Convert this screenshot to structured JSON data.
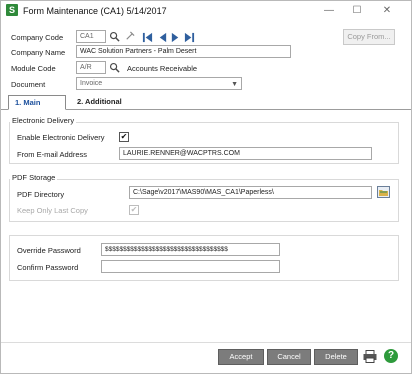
{
  "window": {
    "title": "Form Maintenance (CA1) 5/14/2017",
    "app_icon": "S",
    "icons": {
      "app": "sage-logo-icon",
      "minimize": "minimize-icon",
      "maximize": "maximize-icon",
      "close": "close-icon"
    },
    "minimize_glyph": "—",
    "maximize_glyph": "☐",
    "close_glyph": "✕"
  },
  "header": {
    "company_code_label": "Company Code",
    "company_code_value": "CA1",
    "company_name_label": "Company Name",
    "company_name_value": "WAC Solution Partners - Palm Desert",
    "module_code_label": "Module Code",
    "module_code_value": "A/R",
    "module_name": "Accounts Receivable",
    "document_label": "Document",
    "document_value": "Invoice",
    "copy_from_label": "Copy From..."
  },
  "tabs": [
    {
      "label": "1. Main",
      "active": true
    },
    {
      "label": "2. Additional",
      "active": false
    }
  ],
  "electronic_delivery": {
    "title": "Electronic Delivery",
    "enable_label": "Enable Electronic Delivery",
    "enable_checked": true,
    "from_email_label": "From E-mail Address",
    "from_email_value": "LAURIE.RENNER@WACPTRS.COM"
  },
  "pdf_storage": {
    "title": "PDF Storage",
    "directory_label": "PDF Directory",
    "directory_value": "C:\\Sage\\v2017\\MAS90\\MAS_CA1\\Paperless\\",
    "keep_last_label": "Keep Only Last Copy",
    "keep_last_checked": true
  },
  "passwords": {
    "override_label": "Override Password",
    "override_value": "$$$$$$$$$$$$$$$$$$$$$$$$$$$$$$$$$$",
    "confirm_label": "Confirm Password",
    "confirm_value": ""
  },
  "buttons": {
    "accept": "Accept",
    "cancel": "Cancel",
    "delete": "Delete",
    "help_glyph": "?"
  }
}
